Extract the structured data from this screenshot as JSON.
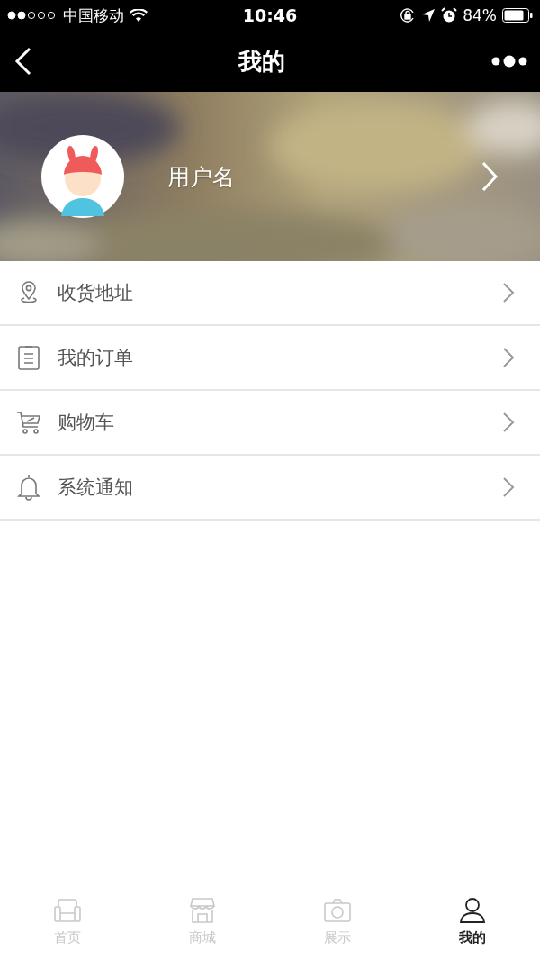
{
  "status_bar": {
    "carrier": "中国移动",
    "time": "10:46",
    "battery": "84%"
  },
  "nav_bar": {
    "title": "我的"
  },
  "profile": {
    "username": "用户名"
  },
  "menu": [
    {
      "kind": "address",
      "label": "收货地址"
    },
    {
      "kind": "orders",
      "label": "我的订单"
    },
    {
      "kind": "cart",
      "label": "购物车"
    },
    {
      "kind": "notice",
      "label": "系统通知"
    }
  ],
  "tabs": [
    {
      "kind": "home",
      "label": "首页",
      "selected": false
    },
    {
      "kind": "shop",
      "label": "商城",
      "selected": false
    },
    {
      "kind": "show",
      "label": "展示",
      "selected": false
    },
    {
      "kind": "me",
      "label": "我的",
      "selected": true
    }
  ]
}
